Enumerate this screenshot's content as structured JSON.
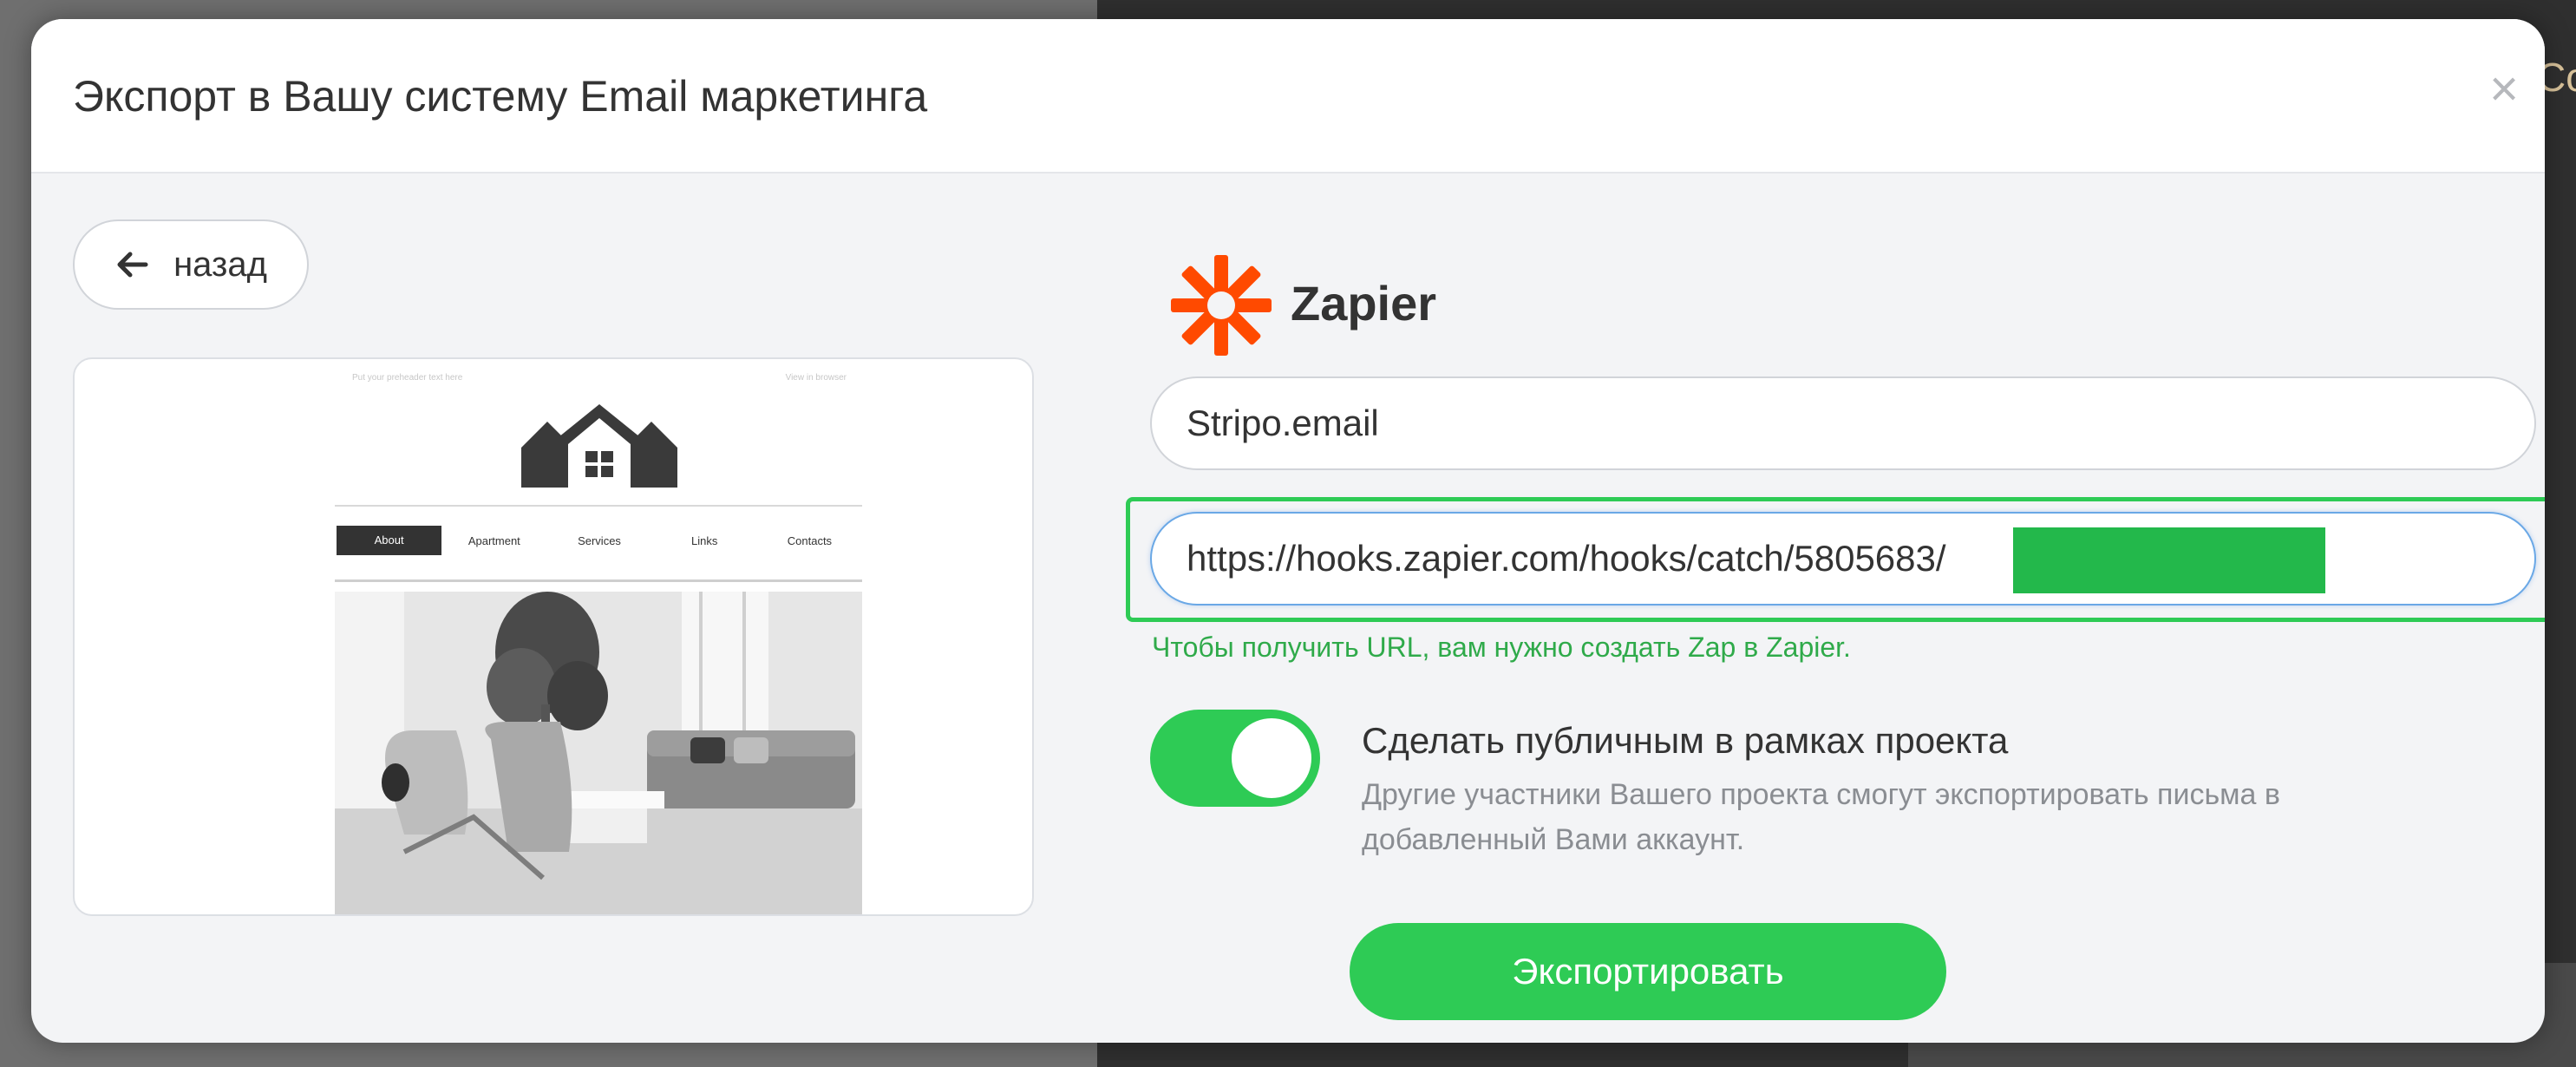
{
  "background": {
    "edge_text": "Co"
  },
  "modal": {
    "title": "Экспорт в Вашу систему Email маркетинга",
    "close_symbol": "×",
    "back": {
      "icon": "arrow-left-icon",
      "label": "назад"
    },
    "preview": {
      "top_left_text": "Put your preheader text here",
      "top_right_text": "View in browser",
      "logo_icon": "house-logo-icon",
      "nav": [
        "About",
        "Apartment",
        "Services",
        "Links",
        "Contacts"
      ]
    },
    "integration": {
      "name": "Zapier",
      "icon": "zapier-asterisk-icon",
      "account_name_value": "Stripo.email",
      "webhook_url_value": "https://hooks.zapier.com/hooks/catch/5805683/",
      "hint": "Чтобы получить URL, вам нужно создать Zap в Zapier."
    },
    "public_toggle": {
      "state": "on",
      "label": "Сделать публичным в рамках проекта",
      "description": "Другие участники Вашего проекта смогут экспортировать письма в добавленный Вами аккаунт."
    },
    "export_button": "Экспортировать"
  },
  "colors": {
    "accent_green": "#2ecb55",
    "hint_green": "#2faa4a",
    "zapier_orange": "#ff4a00",
    "highlight_border": "#2ecb55"
  }
}
